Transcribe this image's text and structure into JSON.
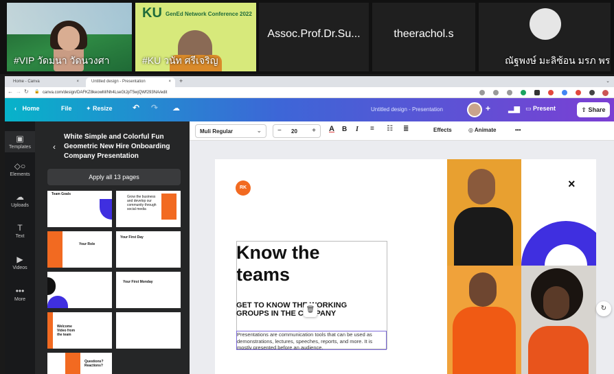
{
  "meeting": {
    "tiles": [
      {
        "name": "#VIP วัดมนา วัดนวงศา"
      },
      {
        "name": "#KU วนัท ศรีเจริญ",
        "banner_logo": "KU",
        "banner_title": "GenEd Network Conference 2022"
      },
      {
        "name": "Assoc.Prof.Dr.Su..."
      },
      {
        "name": "theerachol.s"
      },
      {
        "name": "ณัฐพงษ์ มะลิซ้อน มรภ พร..."
      }
    ]
  },
  "browser": {
    "tabs": [
      {
        "label": "Home - Canva"
      },
      {
        "label": "Untitled design - Presentation"
      }
    ],
    "url": "canva.com/design/DAFKZ8keowM/Nh4LseGtJpT5wjQWf293NA/edit"
  },
  "canva_bar": {
    "home": "Home",
    "file": "File",
    "resize": "Resize",
    "doc_title": "Untitled design - Presentation",
    "present": "Present",
    "share": "Share"
  },
  "rail": {
    "items": [
      {
        "label": "Templates"
      },
      {
        "label": "Elements"
      },
      {
        "label": "Uploads"
      },
      {
        "label": "Text"
      },
      {
        "label": "Videos"
      },
      {
        "label": "More"
      }
    ]
  },
  "panel": {
    "template_title": "White Simple and Colorful Fun Geometric New Hire Onboarding Company Presentation",
    "apply_label": "Apply all 13 pages",
    "thumbs": [
      "Team Goals",
      "Grow the business and develop our community through social media",
      "Your Role",
      "Your First Day",
      "",
      "Your First Monday",
      "Welcome Video from the team",
      "",
      "Questions? Reactions?"
    ]
  },
  "toolbar": {
    "font": "Muli Regular",
    "size": "20",
    "minus": "−",
    "plus": "+",
    "effects": "Effects",
    "animate": "Animate",
    "more": "•••"
  },
  "slide": {
    "badge": "RK",
    "title": "Know the teams",
    "subtitle": "GET TO KNOW THE WORKING GROUPS IN THE COMPANY",
    "body": "Presentations are communication tools that can be used as demonstrations, lectures, speeches, reports, and more. It is mostly presented before an audience.",
    "close": "×"
  },
  "colors": {
    "purple": "#3f2fe0",
    "orange": "#f26a21",
    "canva_gradient_start": "#07b3c9",
    "canva_gradient_end": "#7b3fd3"
  }
}
